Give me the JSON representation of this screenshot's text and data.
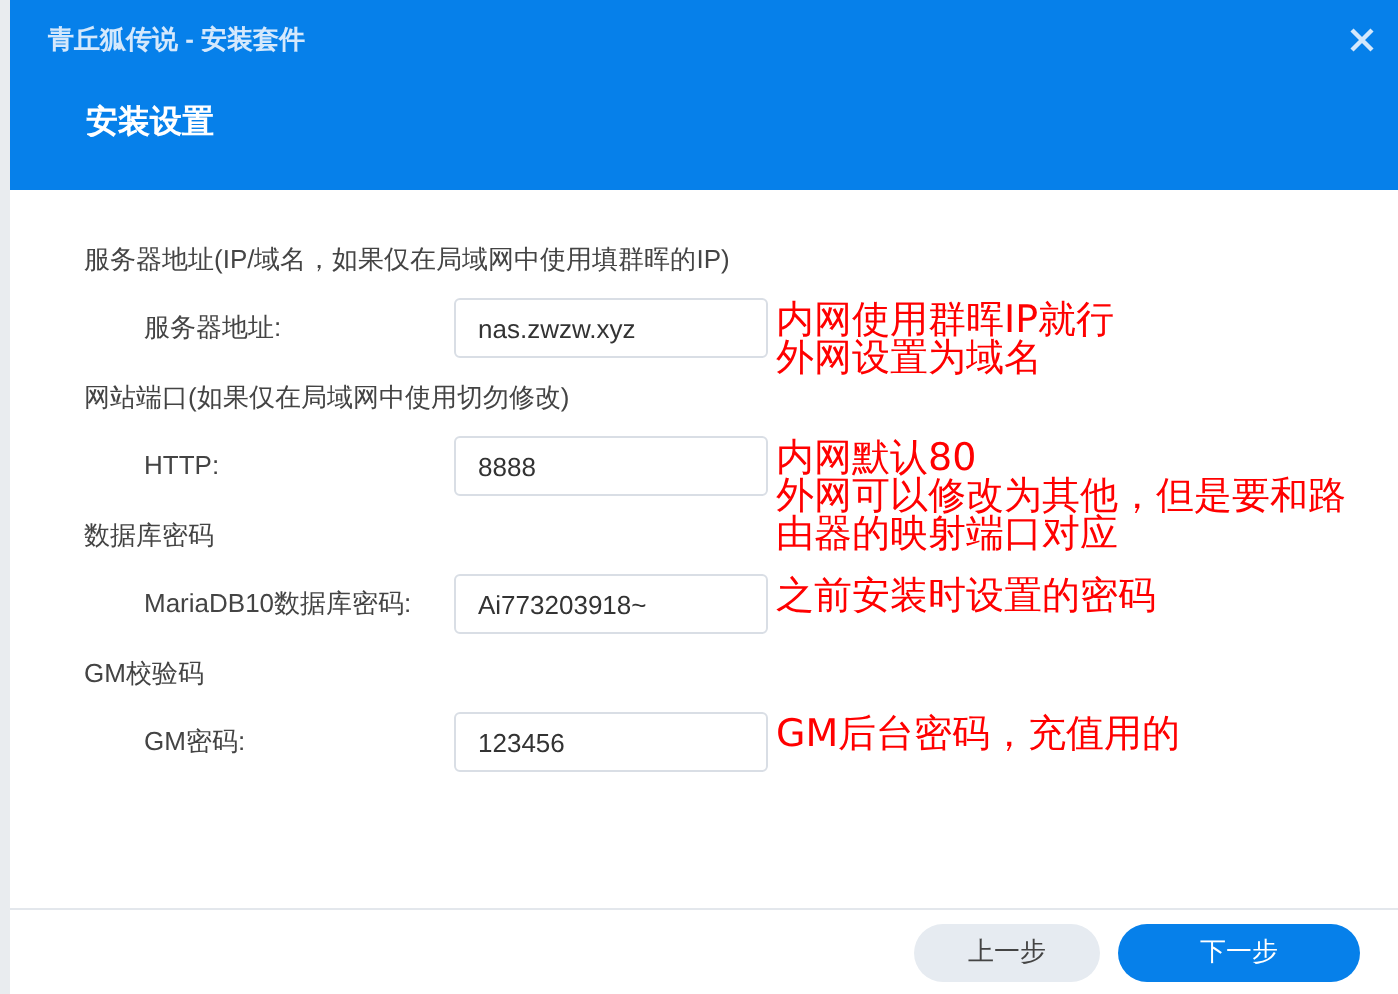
{
  "window": {
    "title": "青丘狐传说 - 安装套件"
  },
  "heading": "安装设置",
  "sections": [
    {
      "label": "服务器地址(IP/域名，如果仅在局域网中使用填群晖的IP)",
      "fields": [
        {
          "label": "服务器地址:",
          "value": "nas.zwzw.xyz",
          "note": [
            "内网使用群晖IP就行",
            "外网设置为域名"
          ]
        }
      ]
    },
    {
      "label": "网站端口(如果仅在局域网中使用切勿修改)",
      "fields": [
        {
          "label": "HTTP:",
          "value": "8888",
          "note": [
            "内网默认80",
            "外网可以修改为其他，但是要和路",
            "由器的映射端口对应"
          ]
        }
      ]
    },
    {
      "label": "数据库密码",
      "fields": [
        {
          "label": "MariaDB10数据库密码:",
          "value": "Ai773203918~",
          "note": [
            "之前安装时设置的密码"
          ]
        }
      ]
    },
    {
      "label": "GM校验码",
      "fields": [
        {
          "label": "GM密码:",
          "value": "123456",
          "note": [
            "GM后台密码，充值用的"
          ]
        }
      ]
    }
  ],
  "buttons": [
    {
      "label": "上一步",
      "kind": "secondary"
    },
    {
      "label": "下一步",
      "kind": "primary"
    }
  ]
}
